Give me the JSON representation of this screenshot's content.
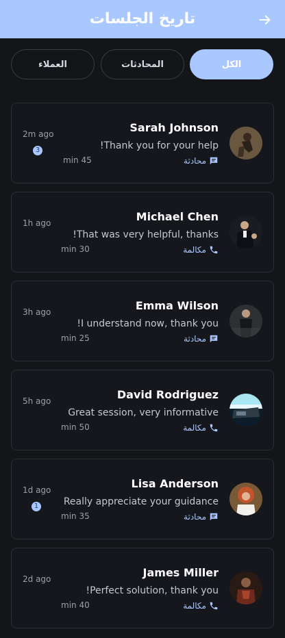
{
  "header": {
    "title": "تاريخ الجلسات",
    "back_icon": "arrow-right-icon"
  },
  "tabs": [
    {
      "label": "الكل",
      "active": true
    },
    {
      "label": "المحادثات",
      "active": false
    },
    {
      "label": "العملاء",
      "active": false
    }
  ],
  "sessions": [
    {
      "name": "Sarah Johnson",
      "message": "!Thank you for your help",
      "type_label": "محادثة",
      "type_icon": "chat-icon",
      "duration": "min 45",
      "time": "2m ago",
      "badge": "3"
    },
    {
      "name": "Michael Chen",
      "message": "!That was very helpful, thanks",
      "type_label": "مكالمة",
      "type_icon": "phone-icon",
      "duration": "min 30",
      "time": "1h ago",
      "badge": ""
    },
    {
      "name": "Emma Wilson",
      "message": "!I understand now, thank you",
      "type_label": "محادثة",
      "type_icon": "chat-icon",
      "duration": "min 25",
      "time": "3h ago",
      "badge": ""
    },
    {
      "name": "David Rodriguez",
      "message": "Great session, very informative",
      "type_label": "مكالمة",
      "type_icon": "phone-icon",
      "duration": "min 50",
      "time": "5h ago",
      "badge": ""
    },
    {
      "name": "Lisa Anderson",
      "message": "Really appreciate your guidance",
      "type_label": "محادثة",
      "type_icon": "chat-icon",
      "duration": "min 35",
      "time": "1d ago",
      "badge": "1"
    },
    {
      "name": "James Miller",
      "message": "!Perfect solution, thank you",
      "type_label": "مكالمة",
      "type_icon": "phone-icon",
      "duration": "min 40",
      "time": "2d ago",
      "badge": ""
    }
  ],
  "colors": {
    "accent": "#a9c8ff",
    "background": "#141519",
    "card_border": "#2b2e36"
  }
}
